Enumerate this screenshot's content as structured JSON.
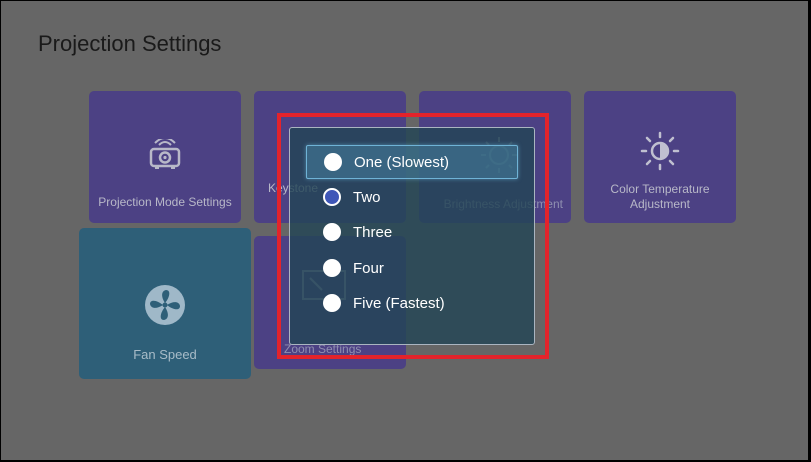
{
  "page": {
    "title": "Projection Settings"
  },
  "tiles": {
    "projection_mode": {
      "label": "Projection Mode Settings",
      "icon": "projector-icon"
    },
    "keystone": {
      "label": "Keystone",
      "icon": "keystone-icon"
    },
    "brightness": {
      "label": "Brightness Adjustment",
      "icon": "brightness-icon"
    },
    "color_temperature": {
      "label": "Color Temperature Adjustment",
      "icon": "color-temperature-icon"
    },
    "fan_speed": {
      "label": "Fan Speed",
      "icon": "fan-icon"
    },
    "zoom": {
      "label": "Zoom Settings",
      "icon": "zoom-icon"
    }
  },
  "dialog": {
    "options": [
      {
        "label": "One (Slowest)",
        "selected": false,
        "focused": true
      },
      {
        "label": "Two",
        "selected": true,
        "focused": false
      },
      {
        "label": "Three",
        "selected": false,
        "focused": false
      },
      {
        "label": "Four",
        "selected": false,
        "focused": false
      },
      {
        "label": "Five (Fastest)",
        "selected": false,
        "focused": false
      }
    ]
  },
  "colors": {
    "background": "#666666",
    "tile": "#4c4184",
    "tile_active": "#2e5f78",
    "dialog": "#234655",
    "highlight": "#e3232b",
    "radio_checked": "#3f57b8"
  }
}
